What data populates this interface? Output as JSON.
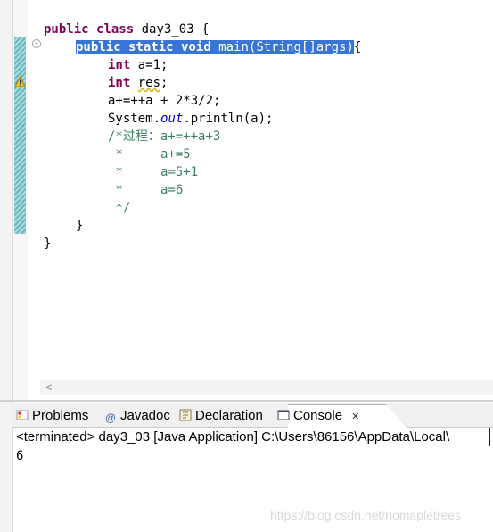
{
  "editor": {
    "lines": [
      {
        "id": "l1",
        "text": "public class day3_03 {"
      },
      {
        "id": "l2",
        "text": "public static void main(String[]args){"
      },
      {
        "id": "l3",
        "text": "int a=1;"
      },
      {
        "id": "l4",
        "text": "int res;"
      },
      {
        "id": "l5",
        "text": "a+=++a + 2*3/2;"
      },
      {
        "id": "l6",
        "text": "System.out.println(a);"
      },
      {
        "id": "l7",
        "text": "/*过程：a+=++a+3"
      },
      {
        "id": "l8",
        "text": " *     a+=5"
      },
      {
        "id": "l9",
        "text": " *     a=5+1"
      },
      {
        "id": "l10",
        "text": " *     a=6"
      },
      {
        "id": "l11",
        "text": " */"
      },
      {
        "id": "l12",
        "text": "}"
      },
      {
        "id": "l13",
        "text": "}"
      }
    ],
    "tokens": {
      "public": "public",
      "class": "class",
      "class_name": " day3_03 {",
      "static": "static",
      "void": "void",
      "main_sig": " main(String[]args)",
      "brace": "{",
      "int": "int",
      "a_init": " a=1;",
      "res_name": "res",
      "semicolon": ";",
      "expr": "a+=++a + 2*3/2;",
      "system": "System.",
      "out": "out",
      "println": ".println(a);",
      "comment1": "/*过程：a+=++a+3",
      "comment2": " *     a+=5",
      "comment3": " *     a=5+1",
      "comment4": " *     a=6",
      "comment5": " */",
      "close_brace": "}"
    }
  },
  "views": {
    "tabs": [
      {
        "label": "Problems",
        "icon": "problems-icon"
      },
      {
        "label": "Javadoc",
        "icon": "at-icon"
      },
      {
        "label": "Declaration",
        "icon": "declaration-icon"
      },
      {
        "label": "Console",
        "icon": "console-icon"
      }
    ],
    "close_glyph": "✕",
    "console_header": "<terminated> day3_03 [Java Application] C:\\Users\\86156\\AppData\\Local\\",
    "console_output": "6",
    "watermark": "https://blog.csdn.net/nomapletrees"
  },
  "colors": {
    "keyword": "#7f0055",
    "static_field": "#0000c0",
    "comment": "#3f7f5f",
    "selection": "#3875d7"
  }
}
